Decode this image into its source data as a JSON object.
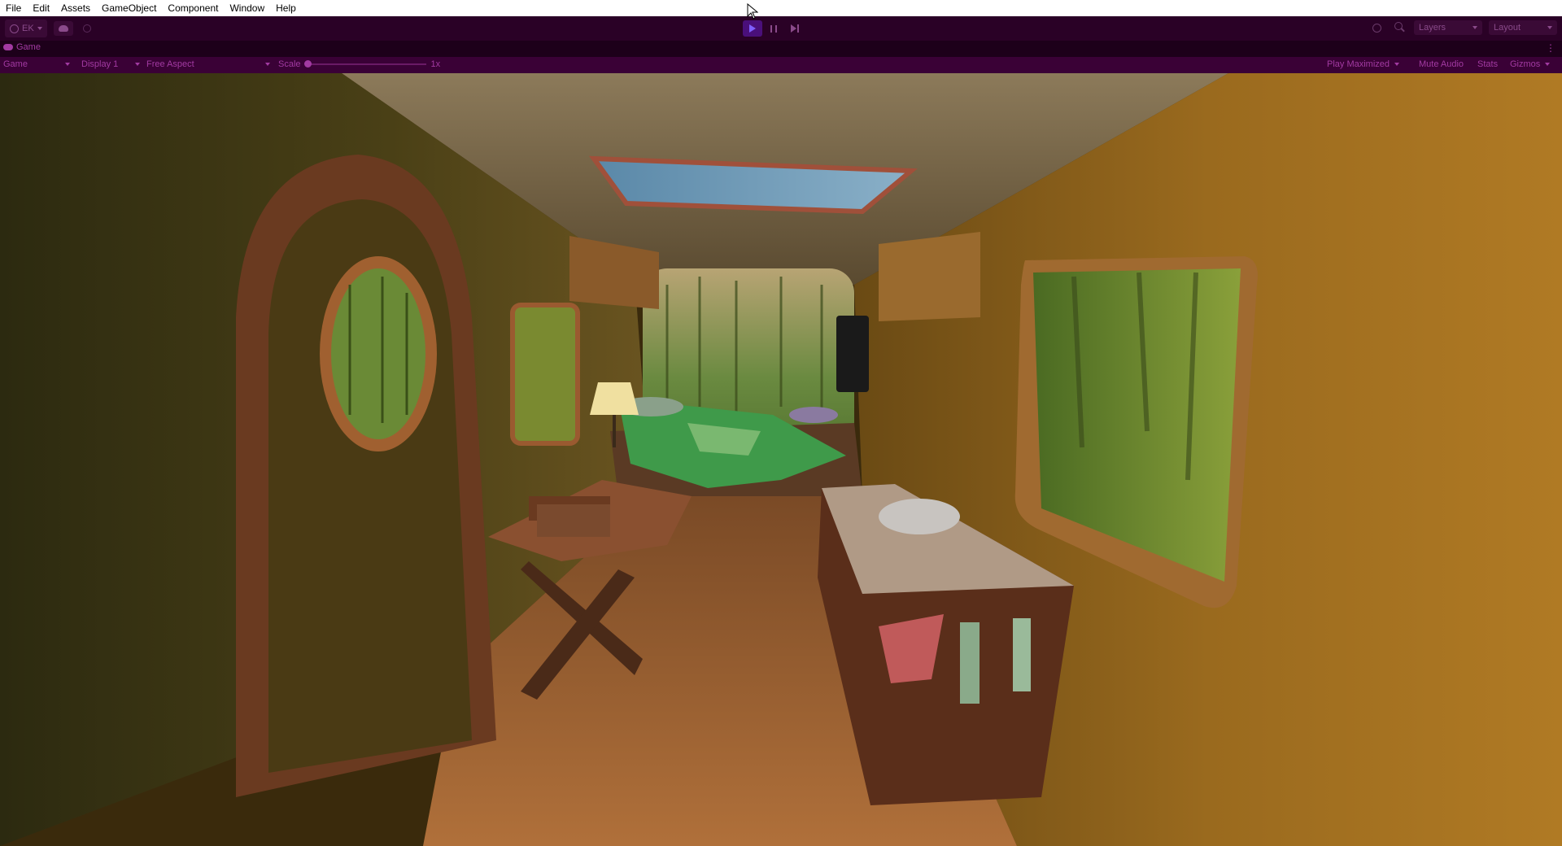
{
  "menu": {
    "items": [
      "File",
      "Edit",
      "Assets",
      "GameObject",
      "Component",
      "Window",
      "Help"
    ]
  },
  "toolbar": {
    "account_label": "EK",
    "layers_label": "Layers",
    "layout_label": "Layout"
  },
  "tab": {
    "label": "Game"
  },
  "game_toolbar": {
    "mode": "Game",
    "display": "Display 1",
    "aspect": "Free Aspect",
    "scale_label": "Scale",
    "scale_value": "1x",
    "play_maximized": "Play Maximized",
    "mute_audio": "Mute Audio",
    "stats": "Stats",
    "gizmos": "Gizmos"
  },
  "colors": {
    "menubar_bg": "#ffffff",
    "toolbar_bg": "#2a0126",
    "game_toolbar_bg": "#3a0136",
    "accent_text": "#a23aa2",
    "play_active": "#4a0f7a"
  },
  "icons": [
    "account-icon",
    "cloud-icon",
    "collab-icon",
    "play-icon",
    "pause-icon",
    "step-icon",
    "history-icon",
    "search-icon",
    "gamepad-icon",
    "kebab-menu-icon",
    "mouse-cursor-icon"
  ]
}
